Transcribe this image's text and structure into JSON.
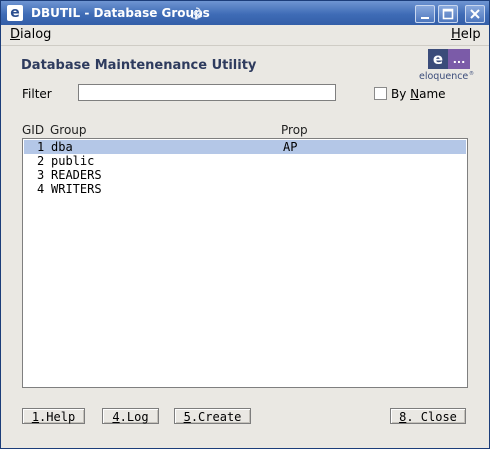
{
  "window": {
    "title": "DBUTIL - Database Groups",
    "app_icon_letter": "e",
    "buttons": [
      "minimize-icon",
      "maximize-icon",
      "close-icon"
    ]
  },
  "menubar": {
    "dialog": {
      "hotkey": "D",
      "rest": "ialog"
    },
    "help": {
      "hotkey": "H",
      "rest": "elp"
    }
  },
  "heading": "Database Maintenenance Utility",
  "logo": {
    "letter": "e",
    "dots": "...",
    "wordmark": "eloquence",
    "mark": "®"
  },
  "filter": {
    "label": "Filter",
    "value": ""
  },
  "by_name": {
    "prefix": "By ",
    "hotkey": "N",
    "rest": "ame",
    "checked": false
  },
  "columns": {
    "gid": "GID",
    "group": "Group",
    "prop": "Prop"
  },
  "rows": [
    {
      "gid": "1",
      "group": "dba",
      "prop": "AP",
      "selected": true
    },
    {
      "gid": "2",
      "group": "public",
      "prop": "",
      "selected": false
    },
    {
      "gid": "3",
      "group": "READERS",
      "prop": "",
      "selected": false
    },
    {
      "gid": "4",
      "group": "WRITERS",
      "prop": "",
      "selected": false
    }
  ],
  "buttons": {
    "help": {
      "hotkey": "1",
      "rest": ".Help"
    },
    "log": {
      "hotkey": "4",
      "rest": ".Log"
    },
    "create": {
      "hotkey": "5",
      "rest": ".Create"
    },
    "close": {
      "hotkey": "8",
      "rest": ". Close"
    }
  },
  "colors": {
    "selection": "#b4c7e7",
    "titlebar": "#3f6cb6",
    "heading": "#2e3b5e",
    "logo_dark": "#3b4c7a",
    "logo_purple": "#7b5ba8"
  }
}
